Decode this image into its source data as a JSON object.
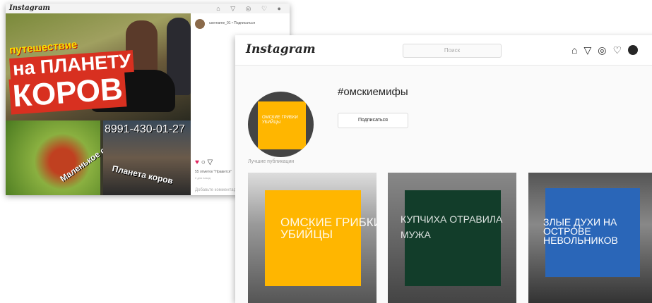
{
  "back_window": {
    "logo": "Instagram",
    "username": "username_01 • Подписаться",
    "photo_text_1": "путешествие",
    "photo_text_2": "на ПЛАНЕТУ",
    "photo_text_3": "КОРОВ",
    "photo_text_4": "8991-430-01-27",
    "photo_text_5": "Планета коров",
    "photo_text_6": "Маленькое счастье",
    "likes": "55 отметок \"Нравится\"",
    "date": "2 дня назад",
    "comment_placeholder": "Добавьте комментарий..."
  },
  "front_window": {
    "logo": "Instagram",
    "search_placeholder": "Поиск",
    "nav_icons": [
      "home-icon",
      "direct-icon",
      "explore-icon",
      "heart-icon",
      "avatar"
    ],
    "profile_image_text": "ОМСКИЕ ГРИБКИ УБИЙЦЫ",
    "hashtag": "#омскиемифы",
    "follow_button": "Подписаться",
    "section_label": "Лучшие публикации",
    "tiles": [
      {
        "text": "ОМСКИЕ ГРИБКИ УБИЙЦЫ",
        "color": "#ffb600"
      },
      {
        "text": "КУПЧИХА ОТРАВИЛА МУЖА",
        "color": "#123d2a"
      },
      {
        "text": "ЗЛЫЕ ДУХИ НА ОСТРОВЕ НЕВОЛЬНИКОВ",
        "color": "#2a66b8"
      }
    ]
  }
}
